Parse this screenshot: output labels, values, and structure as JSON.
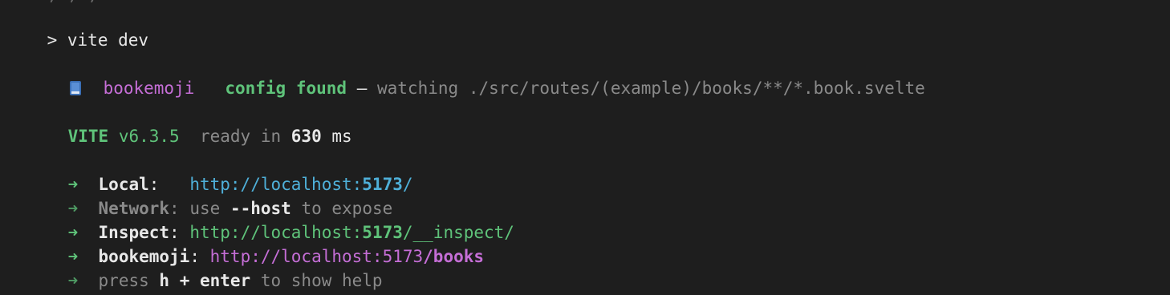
{
  "terminal": {
    "command": {
      "prompt": ">",
      "text": "vite dev"
    },
    "plugin_line": {
      "icon": "book-icon",
      "plugin_name": "bookemoji",
      "status": "config found",
      "dash": "—",
      "watching_label": "watching",
      "watch_path": "./src/routes/(example)/books/**/*.book.svelte"
    },
    "vite_line": {
      "name": "VITE",
      "version": "v6.3.5",
      "ready_label": "ready in",
      "ready_ms": "630",
      "ready_unit": "ms"
    },
    "urls": {
      "arrow": "➜",
      "local": {
        "label": "Local",
        "colon": ":",
        "url_prefix": "http://localhost:",
        "port": "5173",
        "url_suffix": "/"
      },
      "network": {
        "label": "Network",
        "colon": ":",
        "use": "use",
        "flag": "--host",
        "to_expose": "to expose"
      },
      "inspect": {
        "label": "Inspect",
        "colon": ":",
        "url_prefix": "http://localhost:",
        "port": "5173",
        "url_suffix": "/__inspect/"
      },
      "bookemoji": {
        "label": "bookemoji",
        "colon": ":",
        "url_prefix": "http://localhost:5173",
        "url_path": "/books"
      },
      "help": {
        "press": "press",
        "keys": "h + enter",
        "to_show_help": "to show help"
      }
    },
    "colors": {
      "background": "#1e1e1e",
      "green": "#5fc37a",
      "cyan": "#4fb0d9",
      "magenta": "#c56ed6",
      "dim": "#8a8a8a",
      "book_blue": "#3b6fb6"
    }
  }
}
